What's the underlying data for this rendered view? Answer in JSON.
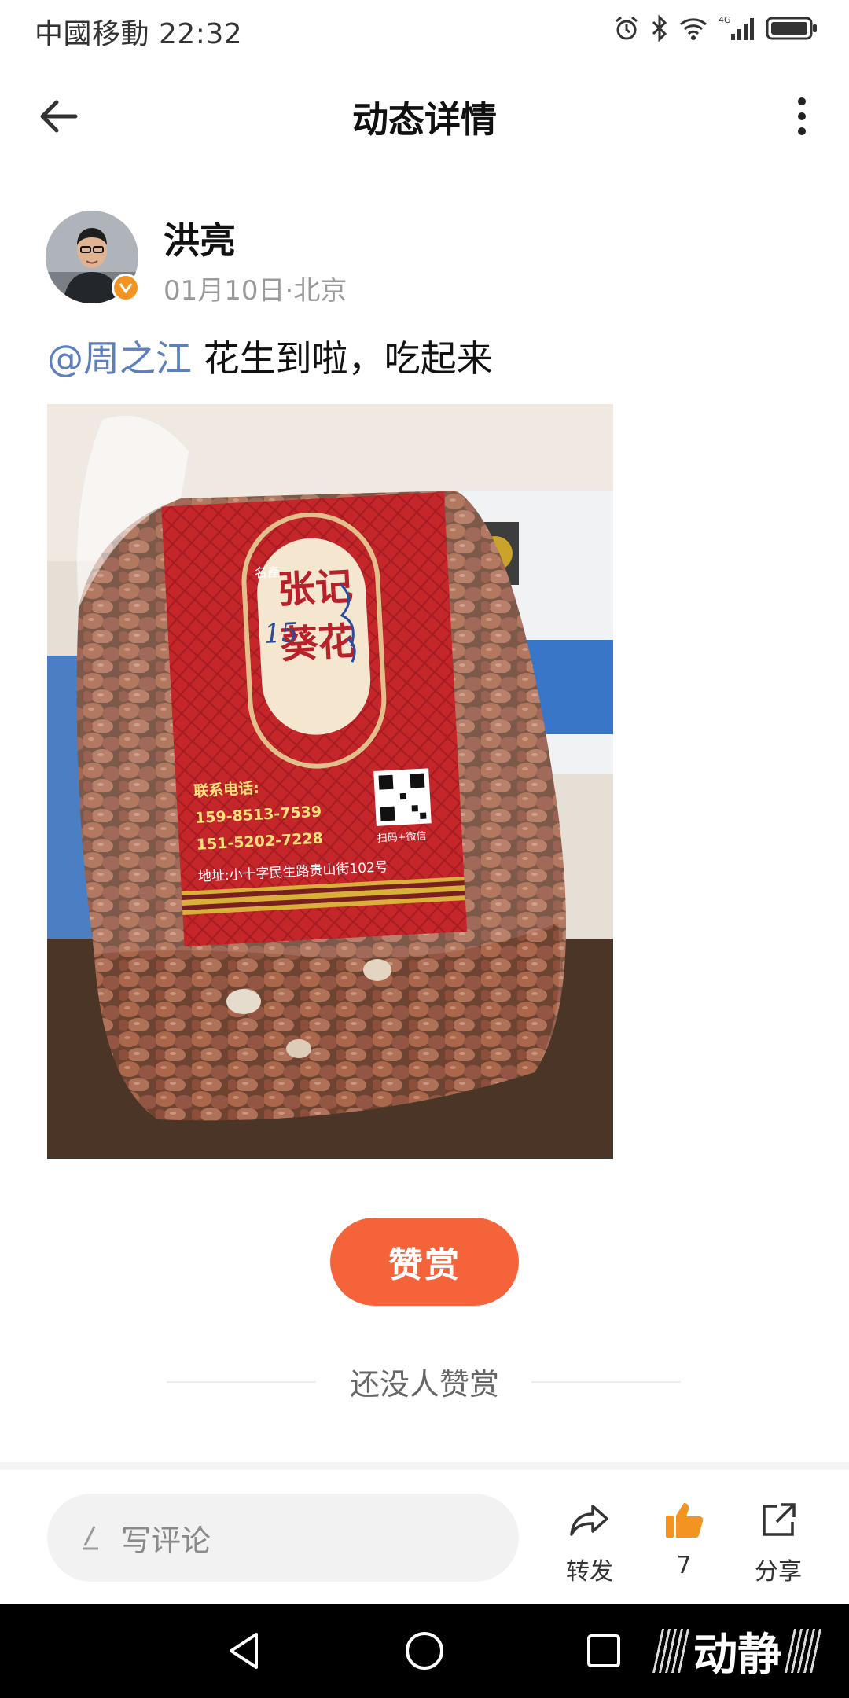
{
  "status_bar": {
    "carrier_time": "中國移動 22:32",
    "network": "4G"
  },
  "header": {
    "title": "动态详情"
  },
  "author": {
    "name": "洪亮",
    "date": "01月10日",
    "location": "北京",
    "meta_separator": "·"
  },
  "post": {
    "mention": "@周之江",
    "text": " 花生到啦，吃起来"
  },
  "photo_label": {
    "brand_lines": [
      "张记",
      "葵花"
    ],
    "tag": "名產",
    "contact_title": "联系电话:",
    "phone1": "159-8513-7539",
    "phone2": "151-5202-7228",
    "scan": "扫码+微信",
    "address": "地址:小十字民生路贵山街102号",
    "handwriting": "15"
  },
  "reward": {
    "button_label": "赞赏",
    "empty_text": "还没人赞赏"
  },
  "bottom_bar": {
    "comment_placeholder": "写评论",
    "repost_label": "转发",
    "like_count": "7",
    "share_label": "分享"
  },
  "watermark": {
    "text": "动静"
  },
  "colors": {
    "accent": "#f5633b",
    "like": "#f39321",
    "mention": "#5b7fbf",
    "meta": "#9a9a9a"
  }
}
